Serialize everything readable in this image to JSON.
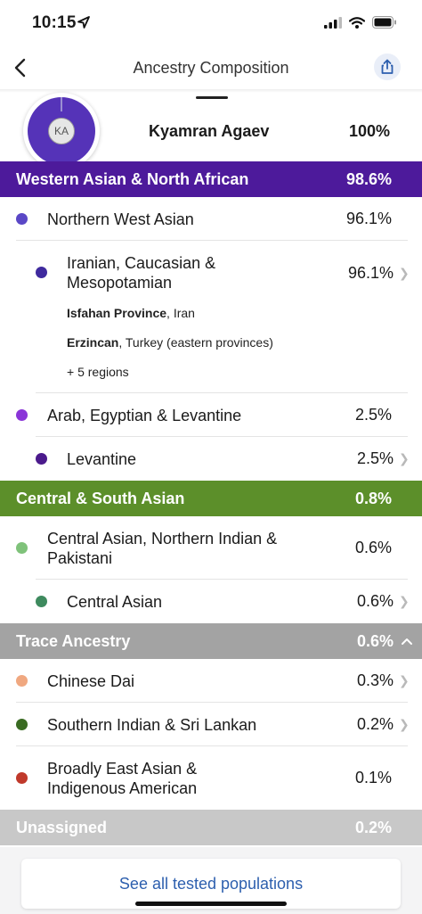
{
  "status_bar": {
    "time": "10:15"
  },
  "nav": {
    "title": "Ancestry Composition"
  },
  "profile": {
    "initials": "KA",
    "name": "Kyamran Agaev",
    "percent": "100%",
    "ring_color": "#5533b8"
  },
  "colors": {
    "western_asian_band": "#4d1a9b",
    "central_south_band": "#5c8f2a",
    "trace_band": "#a3a3a3",
    "unassigned_band": "#c8c8c8",
    "link": "#2d5fae"
  },
  "groups": {
    "western_asian": {
      "label": "Western Asian & North African",
      "percent": "98.6%",
      "northern_west_asian": {
        "label": "Northern West Asian",
        "percent": "96.1%",
        "dot": "#5a47c6"
      },
      "iranian": {
        "label": "Iranian, Caucasian & Mesopotamian",
        "percent": "96.1%",
        "dot": "#3f2a9e",
        "region1_bold": "Isfahan Province",
        "region1_rest": ", Iran",
        "region2_bold": "Erzincan",
        "region2_rest": ", Turkey (eastern provinces)",
        "more": "+ 5 regions"
      },
      "arab": {
        "label": "Arab, Egyptian & Levantine",
        "percent": "2.5%",
        "dot": "#8a35d8"
      },
      "levantine": {
        "label": "Levantine",
        "percent": "2.5%",
        "dot": "#4b1a8c"
      }
    },
    "central_south": {
      "label": "Central & South Asian",
      "percent": "0.8%",
      "central_asian_ni": {
        "label": "Central Asian, Northern Indian & Pakistani",
        "percent": "0.6%",
        "dot": "#7fc27a"
      },
      "central_asian": {
        "label": "Central Asian",
        "percent": "0.6%",
        "dot": "#3e8a5e"
      }
    },
    "trace": {
      "label": "Trace Ancestry",
      "percent": "0.6%",
      "chinese_dai": {
        "label": "Chinese Dai",
        "percent": "0.3%",
        "dot": "#f0a880"
      },
      "southern_indian": {
        "label": "Southern Indian & Sri Lankan",
        "percent": "0.2%",
        "dot": "#3a6b22"
      },
      "east_asian": {
        "label": "Broadly East Asian & Indigenous American",
        "percent": "0.1%",
        "dot": "#c0392b"
      }
    },
    "unassigned": {
      "label": "Unassigned",
      "percent": "0.2%"
    }
  },
  "footer": {
    "see_all": "See all tested populations"
  },
  "icons": {
    "back": "chevron-left-icon",
    "share": "share-icon",
    "chevron": "chevron-right-icon",
    "collapse": "chevron-up-icon"
  }
}
